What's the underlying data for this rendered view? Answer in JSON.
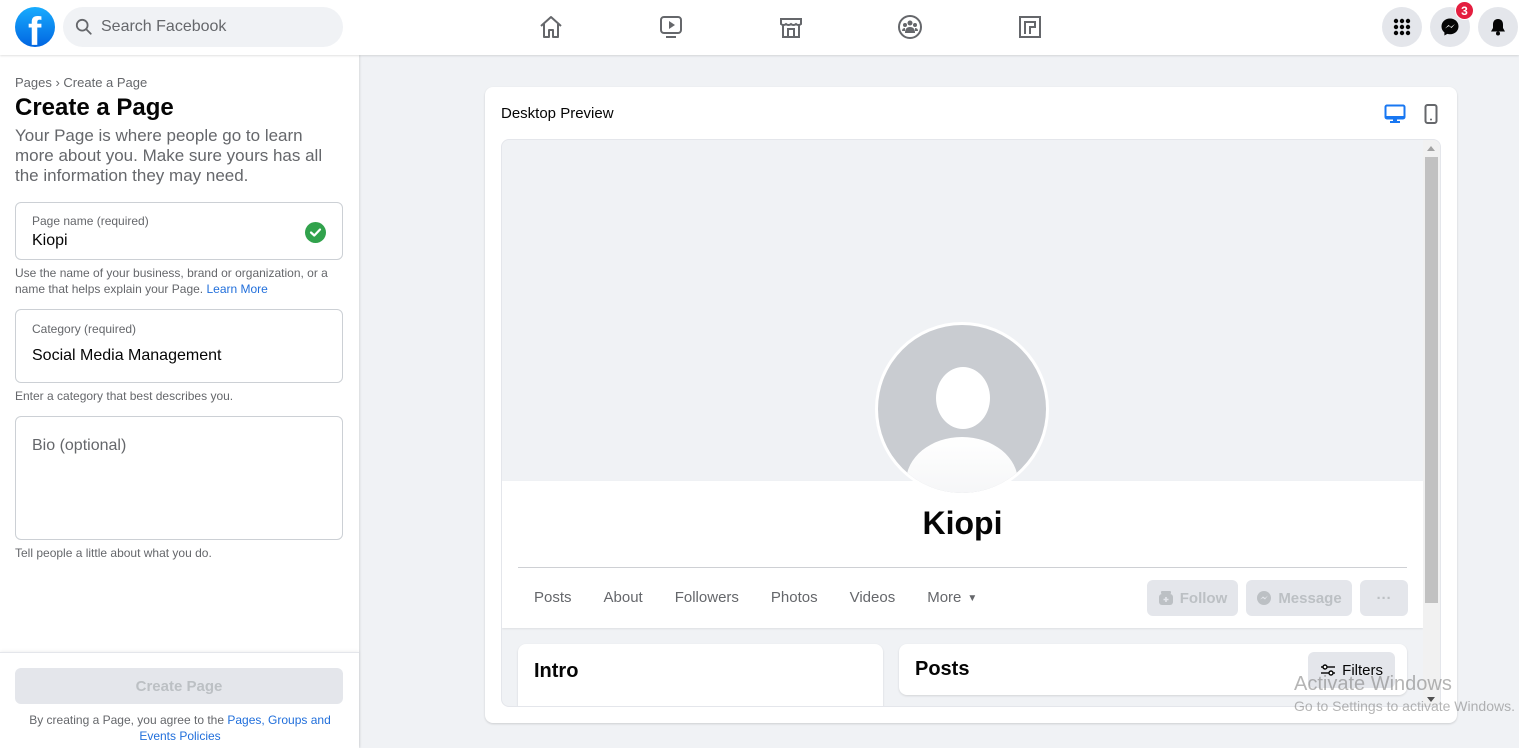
{
  "topbar": {
    "logo": "facebook-logo",
    "logo_glyph": "f",
    "search_placeholder": "Search Facebook",
    "nav": [
      "home-icon",
      "watch-icon",
      "marketplace-icon",
      "groups-icon",
      "gaming-icon"
    ],
    "right": {
      "menu": "menu-grid-icon",
      "messenger": "messenger-icon",
      "messenger_badge": "3",
      "notifications": "bell-icon"
    }
  },
  "left": {
    "breadcrumb": "Pages › Create a Page",
    "title": "Create a Page",
    "intro": "Your Page is where people go to learn more about you. Make sure yours has all the information they may need.",
    "page_name": {
      "label": "Page name (required)",
      "value": "Kiopi",
      "valid": true,
      "help": "Use the name of your business, brand or organization, or a name that helps explain your Page. ",
      "help_link": "Learn More"
    },
    "category": {
      "label": "Category (required)",
      "value": "Social Media Management",
      "help": "Enter a category that best describes you."
    },
    "bio": {
      "placeholder": "Bio (optional)",
      "value": "",
      "help": "Tell people a little about what you do."
    },
    "footer": {
      "create_button": "Create Page",
      "terms_prefix": "By creating a Page, you agree to the ",
      "terms_link": "Pages, Groups and Events Policies"
    }
  },
  "preview": {
    "title": "Desktop Preview",
    "active_device": "desktop",
    "devices": [
      "desktop-icon",
      "mobile-icon"
    ],
    "profile_name": "Kiopi",
    "tabs": [
      "Posts",
      "About",
      "Followers",
      "Photos",
      "Videos",
      "More"
    ],
    "actions": {
      "follow": "Follow",
      "message": "Message",
      "more": "···"
    },
    "intro_card_title": "Intro",
    "posts_card_title": "Posts",
    "filters_label": "Filters"
  },
  "watermark": {
    "line1": "Activate Windows",
    "line2": "Go to Settings to activate Windows."
  },
  "colors": {
    "brand": "#1877f2",
    "link": "#216fdb",
    "success": "#31a24c",
    "badge": "#e41e3f",
    "background": "#f0f2f5"
  }
}
